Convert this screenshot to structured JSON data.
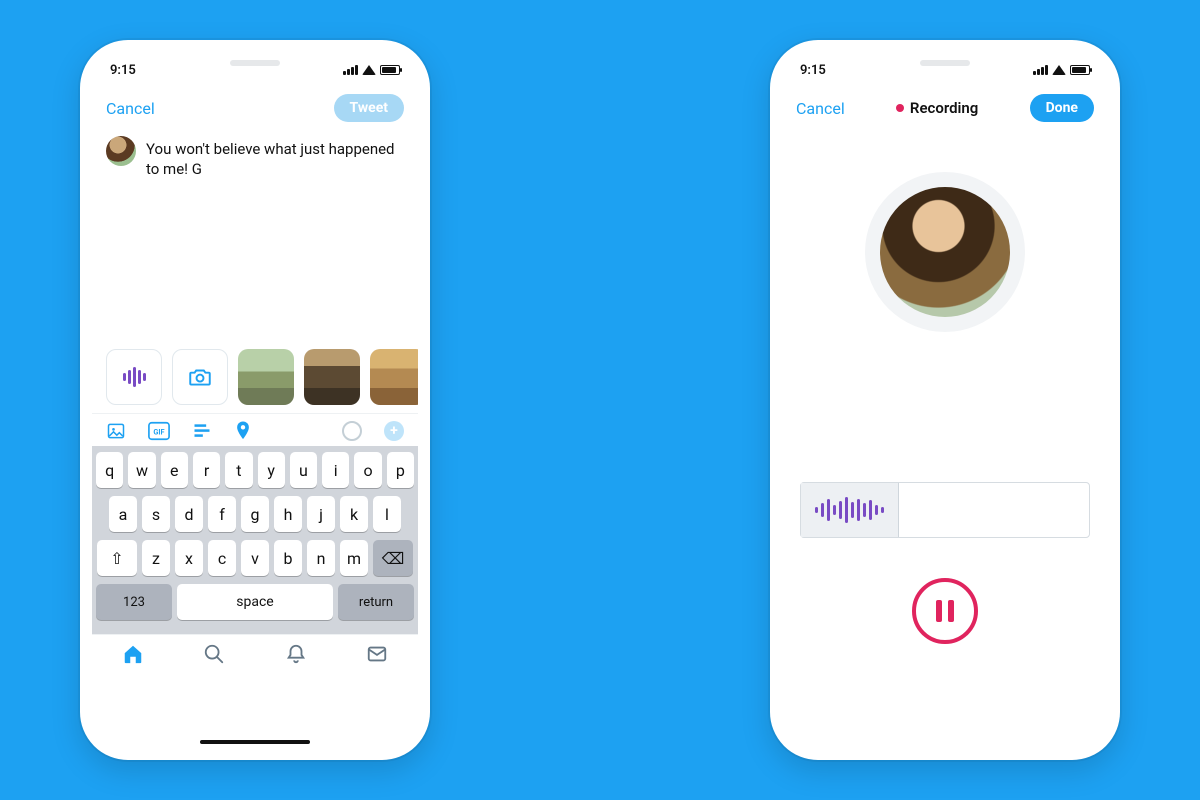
{
  "left": {
    "status": {
      "time": "9:15"
    },
    "nav": {
      "cancel": "Cancel",
      "tweet": "Tweet"
    },
    "compose_text": "You won't believe what just happened to me! G",
    "keyboard": {
      "row1": [
        "q",
        "w",
        "e",
        "r",
        "t",
        "y",
        "u",
        "i",
        "o",
        "p"
      ],
      "row2": [
        "a",
        "s",
        "d",
        "f",
        "g",
        "h",
        "j",
        "k",
        "l"
      ],
      "row3": [
        "z",
        "x",
        "c",
        "v",
        "b",
        "n",
        "m"
      ],
      "numkey": "123",
      "space": "space",
      "return": "return"
    }
  },
  "right": {
    "status": {
      "time": "9:15"
    },
    "nav": {
      "cancel": "Cancel",
      "recording": "Recording",
      "done": "Done"
    }
  }
}
